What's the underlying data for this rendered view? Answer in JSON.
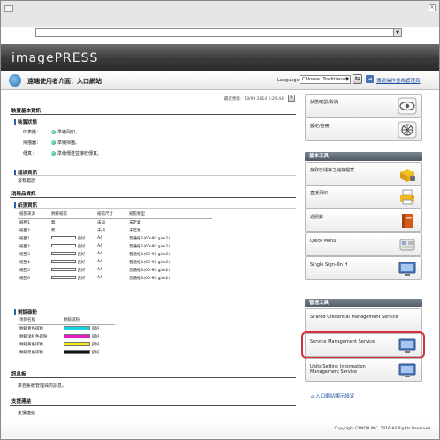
{
  "window": {
    "close_glyph": "×",
    "addr_arrow": "▼"
  },
  "banner": {
    "logo": "imagePRESS"
  },
  "header": {
    "page_title": "遠端使用者介面：入口網站",
    "language_label": "Language:",
    "language_value": "Chinese (Traditional)",
    "language_arrow": "▼",
    "apply_glyph": "⇆",
    "logout_glyph": "⇥",
    "logout_link": "傳送操作並為管理員"
  },
  "main": {
    "last_updated": "最近更新：19/09 2014 6:29:44",
    "refresh_glyph": "↻",
    "device_basic": {
      "title": "裝置基本資訊",
      "status_title": "裝置狀態",
      "rows": [
        {
          "label": "印表機：",
          "status": "準備列印。"
        },
        {
          "label": "掃描器：",
          "status": "準備掃描。"
        },
        {
          "label": "傳真：",
          "status": "準備傳送並接收傳真。"
        }
      ]
    },
    "error_info": {
      "title": "錯誤資訊",
      "text": "沒有錯誤"
    },
    "consumables": {
      "title": "消耗品資訊",
      "paper_title": "紙張資訊",
      "paper_headers": [
        "紙張來源",
        "剩餘紙張",
        "紙張尺寸",
        "紙張類型"
      ],
      "paper_rows": [
        {
          "source": "紙匣1",
          "remain": "無",
          "bar": false,
          "size": "未知",
          "type": "未定義"
        },
        {
          "source": "紙匣2",
          "remain": "無",
          "bar": false,
          "size": "未知",
          "type": "未定義"
        },
        {
          "source": "紙匣1",
          "remain": "良好",
          "bar": true,
          "size": "A4",
          "type": "普通紙1(60-90 g/m2)"
        },
        {
          "source": "紙匣2",
          "remain": "良好",
          "bar": true,
          "size": "A4",
          "type": "普通紙1(60-90 g/m2)"
        },
        {
          "source": "紙匣3",
          "remain": "良好",
          "bar": true,
          "size": "A4",
          "type": "普通紙1(60-90 g/m2)"
        },
        {
          "source": "紙匣4",
          "remain": "良好",
          "bar": true,
          "size": "A4",
          "type": "普通紙1(60-90 g/m2)"
        },
        {
          "source": "紙匣5",
          "remain": "良好",
          "bar": true,
          "size": "A4",
          "type": "普通紙1(60-90 g/m2)"
        },
        {
          "source": "紙匣6",
          "remain": "良好",
          "bar": true,
          "size": "A4",
          "type": "普通紙1(60-90 g/m2)"
        }
      ],
      "toner_title": "剩餘碳粉",
      "toner_headers": [
        "項目名稱",
        "剩餘碳粉"
      ],
      "toner_rows": [
        {
          "name": "剩餘青色碳粉",
          "status": "良好",
          "color": "#19d6e3"
        },
        {
          "name": "剩餘洋紅色碳粉",
          "status": "良好",
          "color": "#e21bc2"
        },
        {
          "name": "剩餘黃色碳粉",
          "status": "良好",
          "color": "#f2ea10"
        },
        {
          "name": "剩餘黑色碳粉",
          "status": "良好",
          "color": "#111111"
        }
      ]
    },
    "messages": {
      "title": "訊息板",
      "text": "來自系統管理員的訊息。"
    },
    "support": {
      "title": "支援連結",
      "text": "支援連結"
    }
  },
  "sidebar": {
    "top_cards": [
      {
        "label": "狀態確認/取消",
        "icon": "eye-icon"
      },
      {
        "label": "設定/註冊",
        "icon": "gear-wheel-icon"
      }
    ],
    "basic_tools_title": "基本工具",
    "basic_cards": [
      {
        "label": "存取已儲存之儲存檔案",
        "icon": "storage-box-icon"
      },
      {
        "label": "直接列印",
        "icon": "printer-icon"
      },
      {
        "label": "通訊錄",
        "icon": "address-book-icon"
      },
      {
        "label": "Quick Menu",
        "icon": "quick-menu-icon"
      },
      {
        "label": "Single Sign-On H",
        "icon": "monitor-icon"
      }
    ],
    "admin_tools_title": "管理工具",
    "admin_cards": [
      {
        "label": "Shared Credential Management Service",
        "icon": "none"
      },
      {
        "label": "Service Management Service",
        "icon": "monitor-icon"
      },
      {
        "label": "Units Setting Information Management Service",
        "icon": "monitor-icon"
      }
    ],
    "portal_link": "入口網站顯示設定",
    "portal_glyph": "⌂"
  },
  "footer": {
    "copyright": "Copyright CANON INC. 2016 All Rights Reserved"
  },
  "colors": {
    "accent_blue": "#2a5ea8",
    "highlight_red": "#d6303a",
    "status_green": "#12a060"
  }
}
